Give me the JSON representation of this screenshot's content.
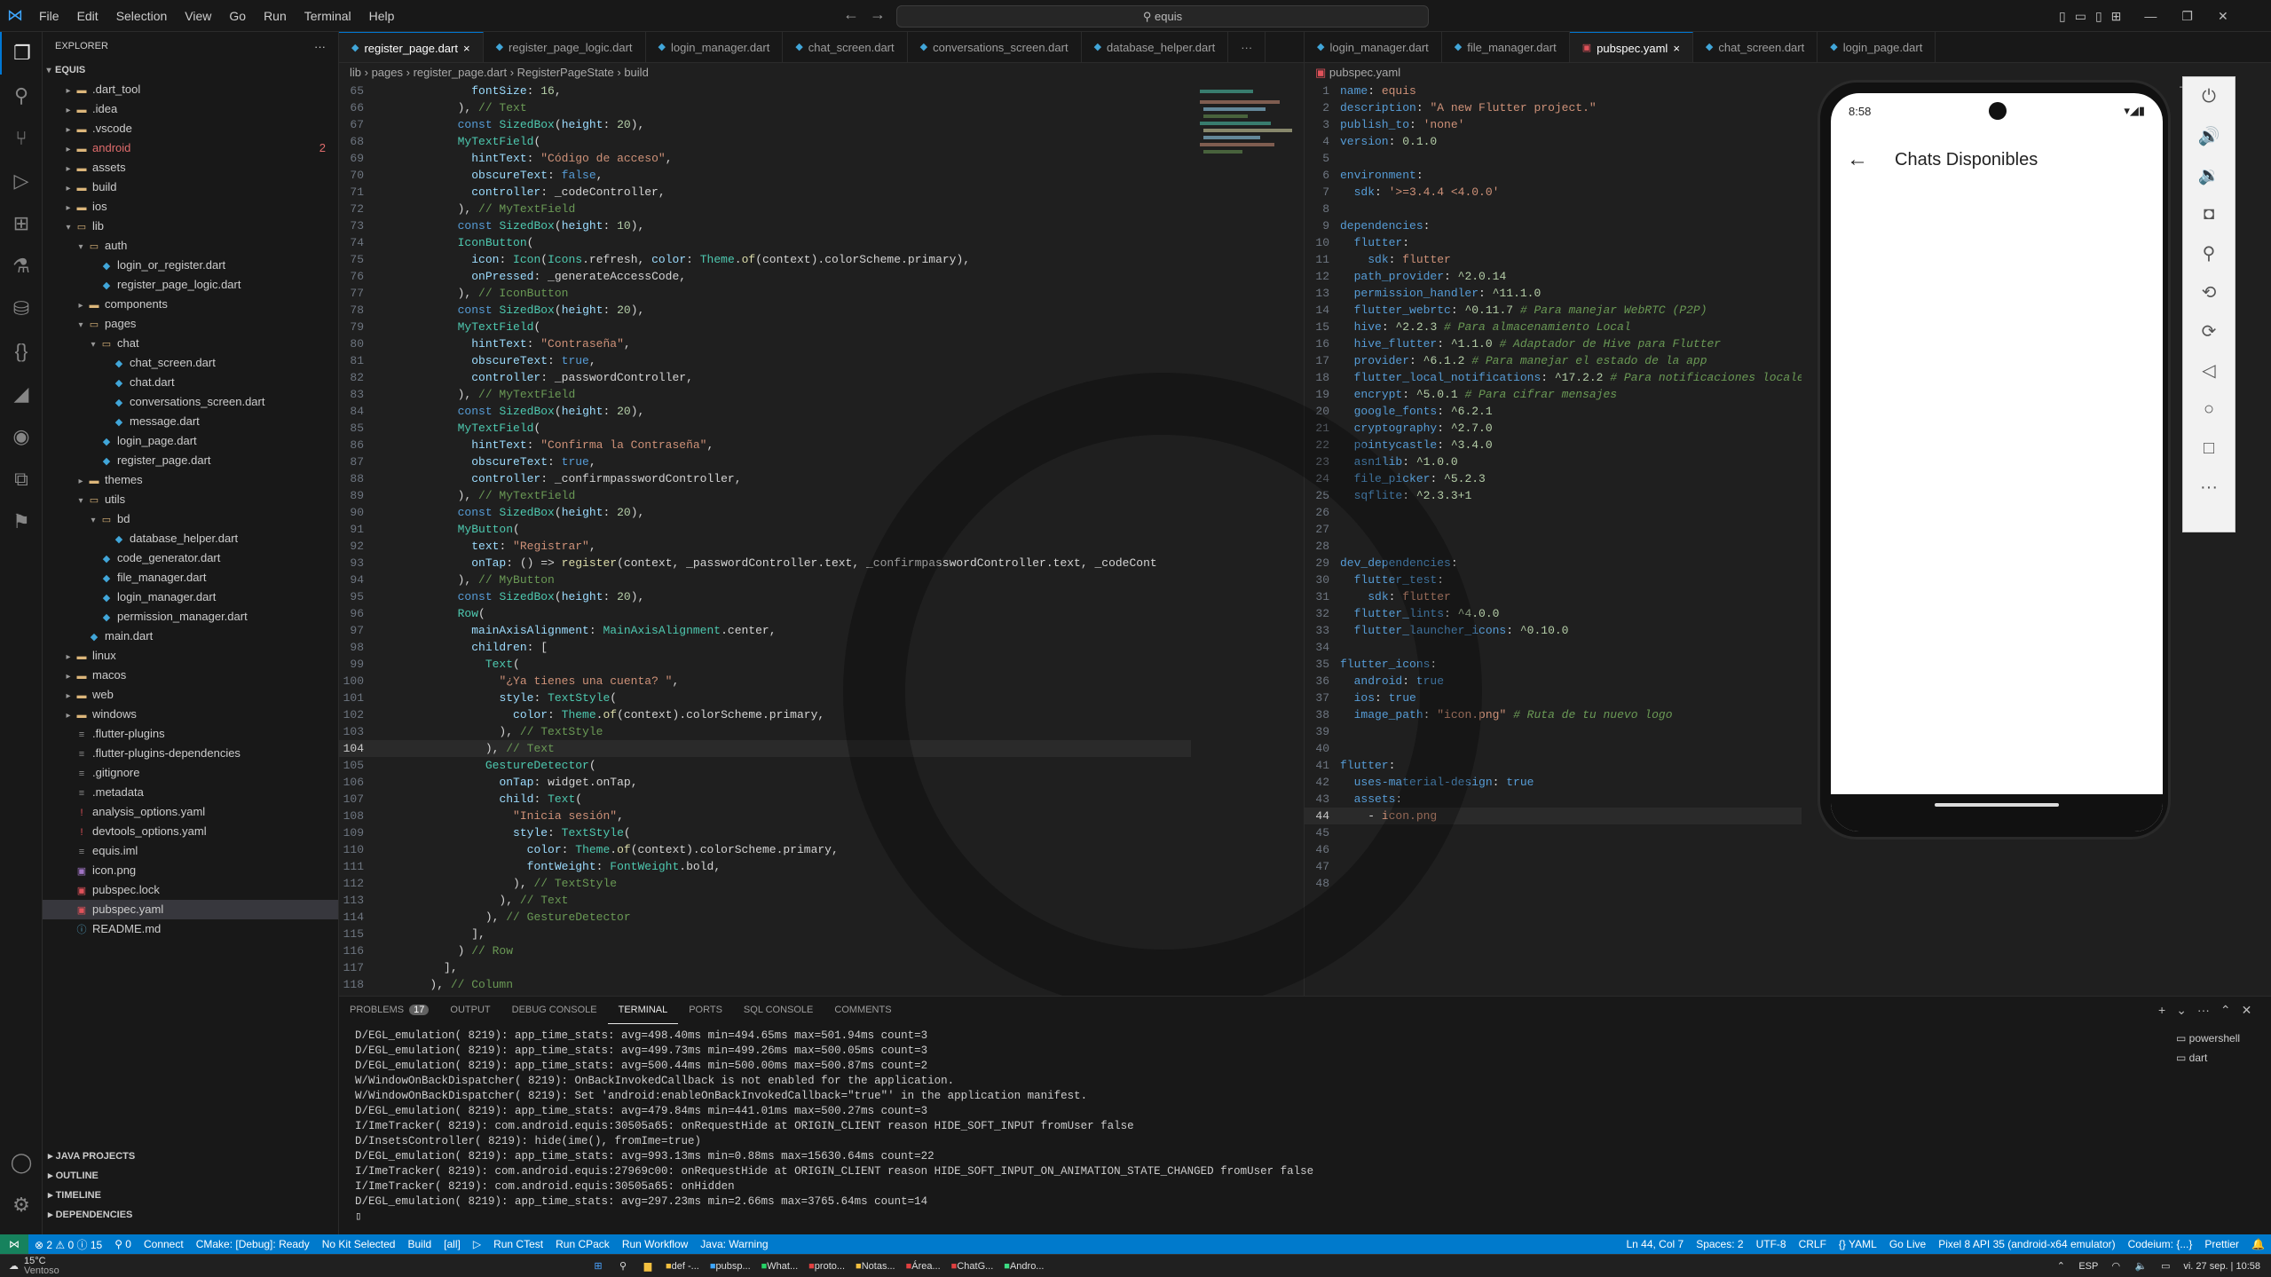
{
  "titlebar": {
    "menus": [
      "File",
      "Edit",
      "Selection",
      "View",
      "Go",
      "Run",
      "Terminal",
      "Help"
    ],
    "search": "equis"
  },
  "sidebar": {
    "header": "EXPLORER",
    "root": "EQUIS",
    "items": [
      {
        "label": ".dart_tool",
        "depth": 1,
        "type": "folder",
        "open": false
      },
      {
        "label": ".idea",
        "depth": 1,
        "type": "folder",
        "open": false
      },
      {
        "label": ".vscode",
        "depth": 1,
        "type": "folder",
        "open": false
      },
      {
        "label": "android",
        "depth": 1,
        "type": "folder",
        "open": false,
        "badge": "2",
        "color": "#e06c6c"
      },
      {
        "label": "assets",
        "depth": 1,
        "type": "folder",
        "open": false
      },
      {
        "label": "build",
        "depth": 1,
        "type": "folder",
        "open": false
      },
      {
        "label": "ios",
        "depth": 1,
        "type": "folder",
        "open": false
      },
      {
        "label": "lib",
        "depth": 1,
        "type": "folder",
        "open": true
      },
      {
        "label": "auth",
        "depth": 2,
        "type": "folder",
        "open": true
      },
      {
        "label": "login_or_register.dart",
        "depth": 3,
        "type": "dart"
      },
      {
        "label": "register_page_logic.dart",
        "depth": 3,
        "type": "dart"
      },
      {
        "label": "components",
        "depth": 2,
        "type": "folder",
        "open": false
      },
      {
        "label": "pages",
        "depth": 2,
        "type": "folder",
        "open": true
      },
      {
        "label": "chat",
        "depth": 3,
        "type": "folder",
        "open": true
      },
      {
        "label": "chat_screen.dart",
        "depth": 4,
        "type": "dart"
      },
      {
        "label": "chat.dart",
        "depth": 4,
        "type": "dart"
      },
      {
        "label": "conversations_screen.dart",
        "depth": 4,
        "type": "dart"
      },
      {
        "label": "message.dart",
        "depth": 4,
        "type": "dart"
      },
      {
        "label": "login_page.dart",
        "depth": 3,
        "type": "dart"
      },
      {
        "label": "register_page.dart",
        "depth": 3,
        "type": "dart"
      },
      {
        "label": "themes",
        "depth": 2,
        "type": "folder",
        "open": false
      },
      {
        "label": "utils",
        "depth": 2,
        "type": "folder",
        "open": true
      },
      {
        "label": "bd",
        "depth": 3,
        "type": "folder",
        "open": true
      },
      {
        "label": "database_helper.dart",
        "depth": 4,
        "type": "dart"
      },
      {
        "label": "code_generator.dart",
        "depth": 3,
        "type": "dart"
      },
      {
        "label": "file_manager.dart",
        "depth": 3,
        "type": "dart"
      },
      {
        "label": "login_manager.dart",
        "depth": 3,
        "type": "dart"
      },
      {
        "label": "permission_manager.dart",
        "depth": 3,
        "type": "dart"
      },
      {
        "label": "main.dart",
        "depth": 2,
        "type": "dart"
      },
      {
        "label": "linux",
        "depth": 1,
        "type": "folder",
        "open": false
      },
      {
        "label": "macos",
        "depth": 1,
        "type": "folder",
        "open": false
      },
      {
        "label": "web",
        "depth": 1,
        "type": "folder",
        "open": false
      },
      {
        "label": "windows",
        "depth": 1,
        "type": "folder",
        "open": false
      },
      {
        "label": ".flutter-plugins",
        "depth": 1,
        "type": "file"
      },
      {
        "label": ".flutter-plugins-dependencies",
        "depth": 1,
        "type": "file"
      },
      {
        "label": ".gitignore",
        "depth": 1,
        "type": "file"
      },
      {
        "label": ".metadata",
        "depth": 1,
        "type": "file"
      },
      {
        "label": "analysis_options.yaml",
        "depth": 1,
        "type": "yaml"
      },
      {
        "label": "devtools_options.yaml",
        "depth": 1,
        "type": "yaml"
      },
      {
        "label": "equis.iml",
        "depth": 1,
        "type": "file"
      },
      {
        "label": "icon.png",
        "depth": 1,
        "type": "image"
      },
      {
        "label": "pubspec.lock",
        "depth": 1,
        "type": "lock"
      },
      {
        "label": "pubspec.yaml",
        "depth": 1,
        "type": "lock",
        "selected": true
      },
      {
        "label": "README.md",
        "depth": 1,
        "type": "md"
      }
    ],
    "bottom_sections": [
      "JAVA PROJECTS",
      "OUTLINE",
      "TIMELINE",
      "DEPENDENCIES"
    ]
  },
  "left_editor": {
    "tabs": [
      {
        "label": "register_page.dart",
        "active": true,
        "close": "×"
      },
      {
        "label": "register_page_logic.dart"
      },
      {
        "label": "login_manager.dart"
      },
      {
        "label": "chat_screen.dart"
      },
      {
        "label": "conversations_screen.dart"
      },
      {
        "label": "database_helper.dart"
      }
    ],
    "more": "···",
    "breadcrumb": [
      "lib",
      "pages",
      "register_page.dart",
      "RegisterPageState",
      "build"
    ],
    "lines": [
      {
        "n": 65,
        "t": "              fontSize: 16,"
      },
      {
        "n": 66,
        "t": "            ), // Text"
      },
      {
        "n": 67,
        "t": "            const SizedBox(height: 20),"
      },
      {
        "n": 68,
        "t": "            MyTextField("
      },
      {
        "n": 69,
        "t": "              hintText: \"Código de acceso\","
      },
      {
        "n": 70,
        "t": "              obscureText: false,"
      },
      {
        "n": 71,
        "t": "              controller: _codeController,"
      },
      {
        "n": 72,
        "t": "            ), // MyTextField"
      },
      {
        "n": 73,
        "t": "            const SizedBox(height: 10),"
      },
      {
        "n": 74,
        "t": "            IconButton("
      },
      {
        "n": 75,
        "t": "              icon: Icon(Icons.refresh, color: Theme.of(context).colorScheme.primary),"
      },
      {
        "n": 76,
        "t": "              onPressed: _generateAccessCode,"
      },
      {
        "n": 77,
        "t": "            ), // IconButton"
      },
      {
        "n": 78,
        "t": "            const SizedBox(height: 20),"
      },
      {
        "n": 79,
        "t": "            MyTextField("
      },
      {
        "n": 80,
        "t": "              hintText: \"Contraseña\","
      },
      {
        "n": 81,
        "t": "              obscureText: true,"
      },
      {
        "n": 82,
        "t": "              controller: _passwordController,"
      },
      {
        "n": 83,
        "t": "            ), // MyTextField"
      },
      {
        "n": 84,
        "t": "            const SizedBox(height: 20),"
      },
      {
        "n": 85,
        "t": "            MyTextField("
      },
      {
        "n": 86,
        "t": "              hintText: \"Confirma la Contraseña\","
      },
      {
        "n": 87,
        "t": "              obscureText: true,"
      },
      {
        "n": 88,
        "t": "              controller: _confirmpasswordController,"
      },
      {
        "n": 89,
        "t": "            ), // MyTextField"
      },
      {
        "n": 90,
        "t": "            const SizedBox(height: 20),"
      },
      {
        "n": 91,
        "t": "            MyButton("
      },
      {
        "n": 92,
        "t": "              text: \"Registrar\","
      },
      {
        "n": 93,
        "t": "              onTap: () => register(context, _passwordController.text, _confirmpasswordController.text, _codeCont"
      },
      {
        "n": 94,
        "t": "            ), // MyButton"
      },
      {
        "n": 95,
        "t": "            const SizedBox(height: 20),"
      },
      {
        "n": 96,
        "t": "            Row("
      },
      {
        "n": 97,
        "t": "              mainAxisAlignment: MainAxisAlignment.center,"
      },
      {
        "n": 98,
        "t": "              children: ["
      },
      {
        "n": 99,
        "t": "                Text("
      },
      {
        "n": 100,
        "t": "                  \"¿Ya tienes una cuenta? \","
      },
      {
        "n": 101,
        "t": "                  style: TextStyle("
      },
      {
        "n": 102,
        "t": "                    color: Theme.of(context).colorScheme.primary,"
      },
      {
        "n": 103,
        "t": "                  ), // TextStyle"
      },
      {
        "n": 104,
        "t": "                ), // Text"
      },
      {
        "n": 105,
        "t": "                GestureDetector("
      },
      {
        "n": 106,
        "t": "                  onTap: widget.onTap,"
      },
      {
        "n": 107,
        "t": "                  child: Text("
      },
      {
        "n": 108,
        "t": "                    \"Inicia sesión\","
      },
      {
        "n": 109,
        "t": "                    style: TextStyle("
      },
      {
        "n": 110,
        "t": "                      color: Theme.of(context).colorScheme.primary,"
      },
      {
        "n": 111,
        "t": "                      fontWeight: FontWeight.bold,"
      },
      {
        "n": 112,
        "t": "                    ), // TextStyle"
      },
      {
        "n": 113,
        "t": "                  ), // Text"
      },
      {
        "n": 114,
        "t": "                ), // GestureDetector"
      },
      {
        "n": 115,
        "t": "              ],"
      },
      {
        "n": 116,
        "t": "            ) // Row"
      },
      {
        "n": 117,
        "t": "          ],"
      },
      {
        "n": 118,
        "t": "        ), // Column"
      }
    ],
    "current_line": 104
  },
  "right_editor": {
    "tabs": [
      {
        "label": "login_manager.dart"
      },
      {
        "label": "file_manager.dart"
      },
      {
        "label": "pubspec.yaml",
        "active": true,
        "close": "×"
      },
      {
        "label": "chat_screen.dart"
      },
      {
        "label": "login_page.dart"
      }
    ],
    "breadcrumb": "pubspec.yaml",
    "lines": [
      "name: equis",
      "description: \"A new Flutter project.\"",
      "publish_to: 'none'",
      "version: 0.1.0",
      "",
      "environment:",
      "  sdk: '>=3.4.4 <4.0.0'",
      "",
      "dependencies:",
      "  flutter:",
      "    sdk: flutter",
      "  path_provider: ^2.0.14",
      "  permission_handler: ^11.1.0",
      "  flutter_webrtc: ^0.11.7 # Para manejar WebRTC (P2P)",
      "  hive: ^2.2.3 # Para almacenamiento Local",
      "  hive_flutter: ^1.1.0 # Adaptador de Hive para Flutter",
      "  provider: ^6.1.2 # Para manejar el estado de la app",
      "  flutter_local_notifications: ^17.2.2 # Para notificaciones locales",
      "  encrypt: ^5.0.1 # Para cifrar mensajes",
      "  google_fonts: ^6.2.1",
      "  cryptography: ^2.7.0",
      "  pointycastle: ^3.4.0",
      "  asn1lib: ^1.0.0",
      "  file_picker: ^5.2.3",
      "  sqflite: ^2.3.3+1",
      "",
      "",
      "",
      "dev_dependencies:",
      "  flutter_test:",
      "    sdk: flutter",
      "  flutter_lints: ^4.0.0",
      "  flutter_launcher_icons: ^0.10.0",
      "",
      "flutter_icons:",
      "  android: true",
      "  ios: true",
      "  image_path: \"icon.png\" # Ruta de tu nuevo logo",
      "",
      "",
      "flutter:",
      "  uses-material-design: true",
      "  assets:",
      "    - icon.png",
      "",
      "",
      "",
      ""
    ],
    "current_line": 44
  },
  "panel": {
    "tabs": [
      {
        "label": "PROBLEMS",
        "badge": "17"
      },
      {
        "label": "OUTPUT"
      },
      {
        "label": "DEBUG CONSOLE"
      },
      {
        "label": "TERMINAL",
        "active": true
      },
      {
        "label": "PORTS"
      },
      {
        "label": "SQL CONSOLE"
      },
      {
        "label": "COMMENTS"
      }
    ],
    "terminal_lines": [
      "D/EGL_emulation( 8219): app_time_stats: avg=498.40ms min=494.65ms max=501.94ms count=3",
      "D/EGL_emulation( 8219): app_time_stats: avg=499.73ms min=499.26ms max=500.05ms count=3",
      "D/EGL_emulation( 8219): app_time_stats: avg=500.44ms min=500.00ms max=500.87ms count=2",
      "W/WindowOnBackDispatcher( 8219): OnBackInvokedCallback is not enabled for the application.",
      "W/WindowOnBackDispatcher( 8219): Set 'android:enableOnBackInvokedCallback=\"true\"' in the application manifest.",
      "D/EGL_emulation( 8219): app_time_stats: avg=479.84ms min=441.01ms max=500.27ms count=3",
      "I/ImeTracker( 8219): com.android.equis:30505a65: onRequestHide at ORIGIN_CLIENT reason HIDE_SOFT_INPUT fromUser false",
      "D/InsetsController( 8219): hide(ime(), fromIme=true)",
      "D/EGL_emulation( 8219): app_time_stats: avg=993.13ms min=0.88ms max=15630.64ms count=22",
      "I/ImeTracker( 8219): com.android.equis:27969c00: onRequestHide at ORIGIN_CLIENT reason HIDE_SOFT_INPUT_ON_ANIMATION_STATE_CHANGED fromUser false",
      "I/ImeTracker( 8219): com.android.equis:30505a65: onHidden",
      "D/EGL_emulation( 8219): app_time_stats: avg=297.23ms min=2.66ms max=3765.64ms count=14"
    ],
    "terminals": [
      "powershell",
      "dart"
    ]
  },
  "status": {
    "left": [
      "⊗ 2 ⚠ 0 ⓘ 15",
      "⚲ 0",
      "Connect",
      "CMake: [Debug]: Ready",
      "No Kit Selected",
      "Build",
      "[all]",
      "▷",
      "Run CTest",
      "Run CPack",
      "Run Workflow",
      "Java: Warning"
    ],
    "right": [
      "Ln 44, Col 7",
      "Spaces: 2",
      "UTF-8",
      "CRLF",
      "{} YAML",
      "Go Live",
      "Pixel 8 API 35 (android-x64 emulator)",
      "Codeium: {...}",
      "Prettier"
    ]
  },
  "emulator": {
    "time": "8:58",
    "title": "Chats Disponibles"
  },
  "taskbar": {
    "weather_temp": "15°C",
    "weather_text": "Ventoso",
    "apps": [
      "def -...",
      "pubsp...",
      "What...",
      "proto...",
      "Notas...",
      "Área...",
      "ChatG...",
      "Andro..."
    ],
    "lang": "ESP",
    "clock": "vi. 27 sep. | 10:58"
  }
}
